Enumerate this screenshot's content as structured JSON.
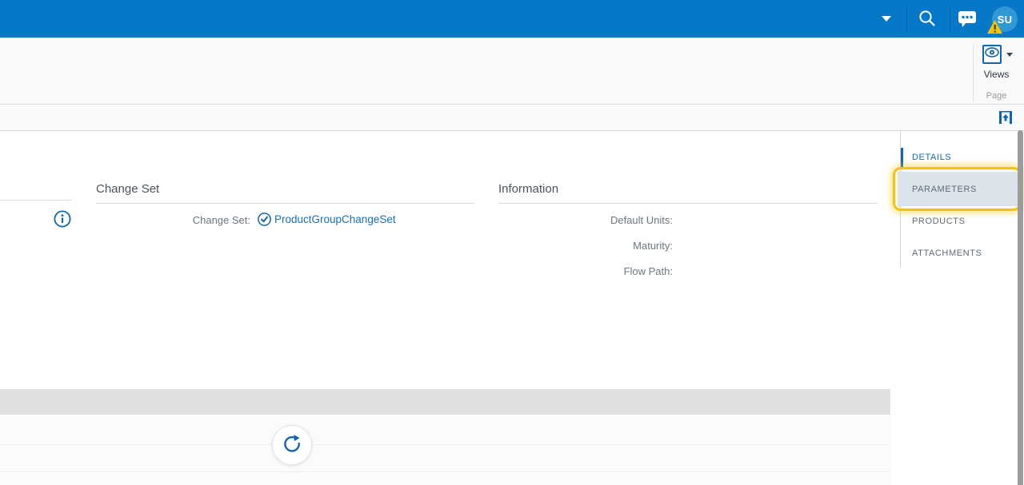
{
  "topbar": {
    "avatar_initials": "SU"
  },
  "ribbon": {
    "views_label": "Views",
    "group_label": "Page"
  },
  "sections": {
    "change_set": {
      "title": "Change Set",
      "field_label": "Change Set:",
      "field_value": "ProductGroupChangeSet"
    },
    "information": {
      "title": "Information",
      "fields": [
        {
          "label": "Default Units:",
          "value": ""
        },
        {
          "label": "Maturity:",
          "value": ""
        },
        {
          "label": "Flow Path:",
          "value": ""
        }
      ]
    }
  },
  "sidebar": {
    "tabs": [
      {
        "label": "DETAILS",
        "state": "active"
      },
      {
        "label": "PARAMETERS",
        "state": "highlighted"
      },
      {
        "label": "PRODUCTS",
        "state": "normal"
      },
      {
        "label": "ATTACHMENTS",
        "state": "normal"
      }
    ]
  },
  "icons": {
    "topbar": [
      "chevron-down",
      "search",
      "chat",
      "avatar",
      "warning-badge"
    ],
    "ribbon": [
      "eye-views",
      "chevron-down"
    ],
    "toolbar": [
      "collapse-panel"
    ],
    "content": [
      "info-circle",
      "check-circle",
      "refresh"
    ]
  },
  "colors": {
    "header_blue": "#0778c8",
    "avatar_blue": "#2f98d5",
    "accent_blue": "#1165ad",
    "link_blue": "#1a6fb5",
    "highlight_yellow": "#f3c313",
    "warning_yellow": "#f2c400",
    "parameters_tab_bg": "#dce4eb",
    "grid_header_gray": "#e0e0e0"
  }
}
